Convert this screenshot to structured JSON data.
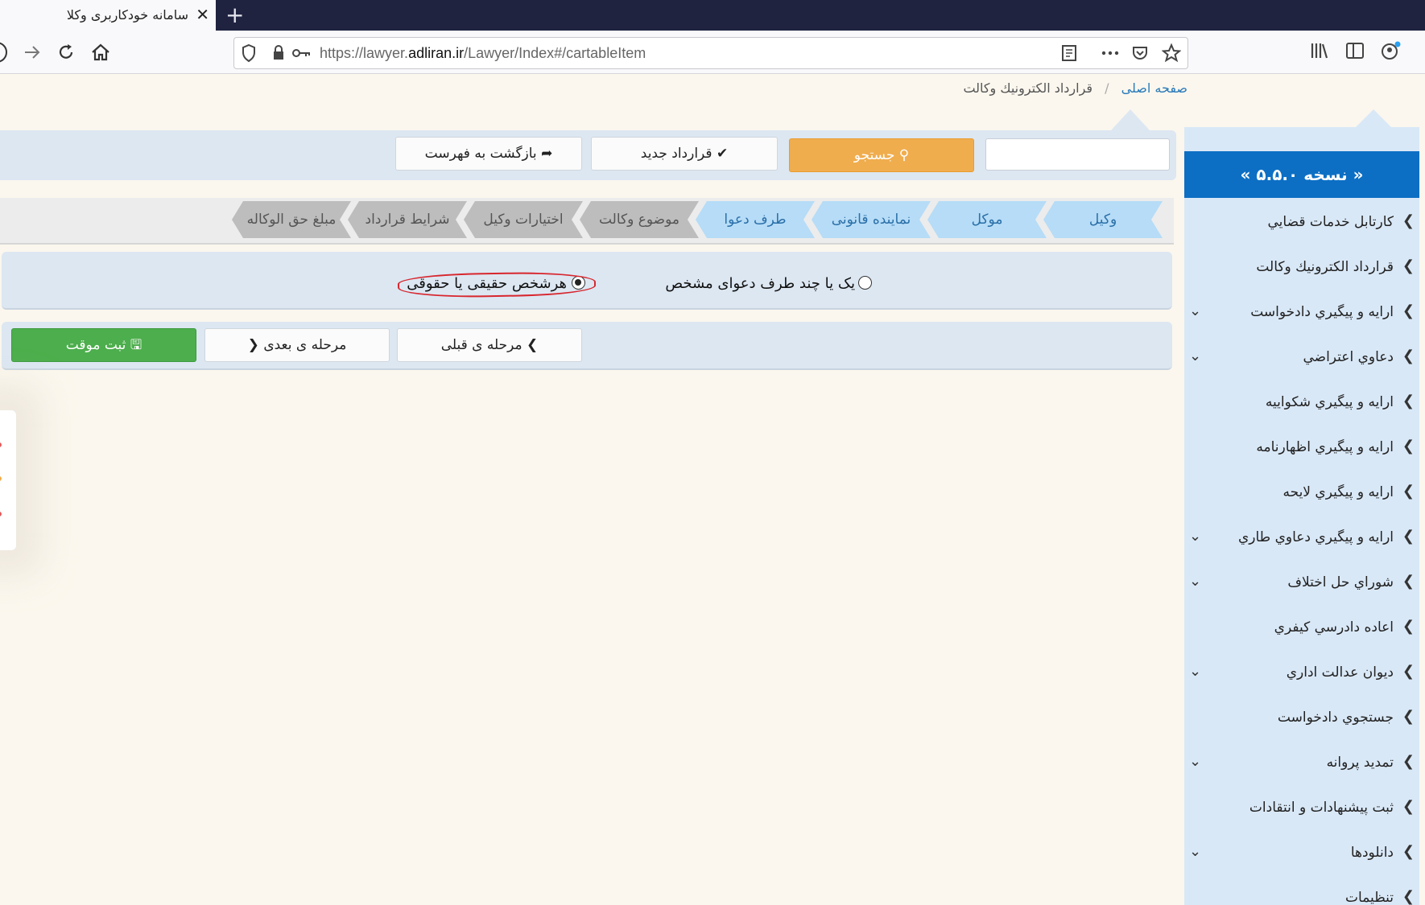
{
  "browser": {
    "tab_title": "سامانه خودکاربری وکلا",
    "tab_close": "✕",
    "new_tab": "+",
    "url_prefix": "https://lawyer.",
    "url_domain": "adliran.ir",
    "url_path": "/Lawyer/Index#/cartableItem"
  },
  "breadcrumb": {
    "home": "صفحه اصلی",
    "separator": "/",
    "current": "قرارداد الکترونيك وكالت"
  },
  "sidebar": {
    "version": "« نسخه ۵.۵.۰ »",
    "items": [
      {
        "label": "کارتابل خدمات قضايي",
        "expandable": false
      },
      {
        "label": "قرارداد الکترونيك وكالت",
        "expandable": false
      },
      {
        "label": "ارايه و پيگيري دادخواست",
        "expandable": true
      },
      {
        "label": "دعاوي اعتراضي",
        "expandable": true
      },
      {
        "label": "ارايه و پيگيري شکواييه",
        "expandable": false
      },
      {
        "label": "ارايه و پيگيري اظهارنامه",
        "expandable": false
      },
      {
        "label": "ارايه و پيگيري لايحه",
        "expandable": false
      },
      {
        "label": "ارايه و پيگيري دعاوي طاري",
        "expandable": true
      },
      {
        "label": "شوراي حل اختلاف",
        "expandable": true
      },
      {
        "label": "اعاده دادرسي كيفري",
        "expandable": false
      },
      {
        "label": "ديوان عدالت اداري",
        "expandable": true
      },
      {
        "label": "جستجوي دادخواست",
        "expandable": false
      },
      {
        "label": "تمديد پروانه",
        "expandable": true
      },
      {
        "label": "ثبت پيشنهادات و انتقادات",
        "expandable": false
      },
      {
        "label": "دانلودها",
        "expandable": true
      },
      {
        "label": "تنظيمات",
        "expandable": false
      }
    ]
  },
  "toolbar": {
    "search_label": "جستجو",
    "new_contract_label": "قرارداد جديد",
    "back_to_list_label": "بازگشت به فهرست",
    "search_placeholder": ""
  },
  "steps": [
    {
      "label": "وکیل",
      "state": "active"
    },
    {
      "label": "موکل",
      "state": "active"
    },
    {
      "label": "نماینده قانونی",
      "state": "active"
    },
    {
      "label": "طرف دعوا",
      "state": "active"
    },
    {
      "label": "موضوع وکالت",
      "state": "inactive"
    },
    {
      "label": "اختیارات وکیل",
      "state": "inactive"
    },
    {
      "label": "شرایط قرارداد",
      "state": "inactive"
    },
    {
      "label": "مبلغ حق الوکاله",
      "state": "inactive"
    }
  ],
  "party_options": {
    "option_specific": "یک یا چند طرف دعوای مشخص",
    "option_any": "هرشخص حقیقی یا حقوقی",
    "selected": "option_any"
  },
  "actions": {
    "prev_label": "مرحله ی قبلی",
    "next_label": "مرحله ی بعدی",
    "save_draft_label": "ثبت موقت"
  },
  "colors": {
    "accent_blue": "#0c6fc4",
    "orange": "#f0ad4e",
    "green": "#4cae4c",
    "step_active": "#b6dcf7",
    "step_inactive": "#bdbdbd"
  }
}
